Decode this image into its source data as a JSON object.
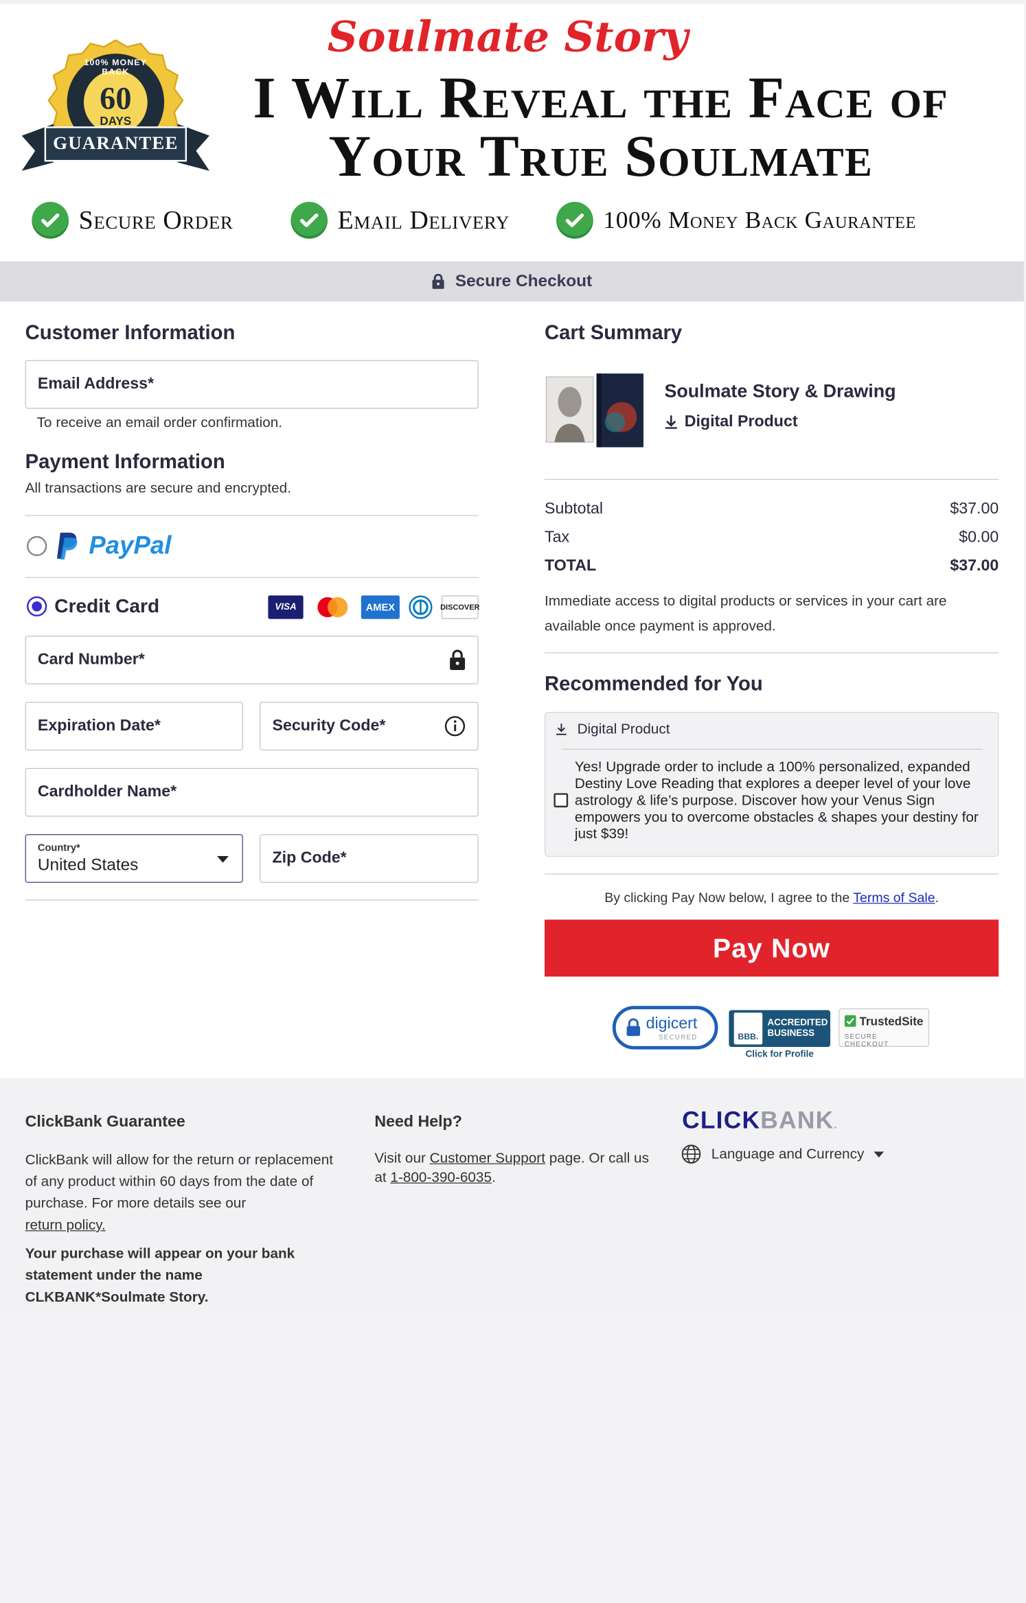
{
  "banner": {
    "brand": "Soulmate Story",
    "headline_line1": "I Will Reveal the Face of",
    "headline_line2": "Your True Soulmate",
    "badge": {
      "top_text": "100% MONEY BACK",
      "number": "60",
      "unit": "DAYS",
      "ribbon": "GUARANTEE"
    },
    "trust_items": [
      "Secure Order",
      "Email Delivery",
      "100% Money Back Gaurantee"
    ]
  },
  "secure_bar": {
    "label": "Secure Checkout"
  },
  "customer": {
    "heading": "Customer Information",
    "email_placeholder": "Email Address*",
    "email_hint": "To receive an email order confirmation."
  },
  "payment": {
    "heading": "Payment Information",
    "subheading": "All transactions are secure and encrypted.",
    "paypal_label": "PayPal",
    "credit_label": "Credit Card",
    "selected_method": "credit-card",
    "card_brands": [
      "VISA",
      "MasterCard",
      "AMEX",
      "Diners",
      "DISCOVER"
    ],
    "card_number_placeholder": "Card Number*",
    "expiration_placeholder": "Expiration Date*",
    "security_placeholder": "Security Code*",
    "cardholder_placeholder": "Cardholder Name*",
    "country_label": "Country*",
    "country_value": "United States",
    "zip_placeholder": "Zip Code*"
  },
  "cart": {
    "heading": "Cart Summary",
    "product_name": "Soulmate Story & Drawing",
    "product_type": "Digital Product",
    "subtotal_label": "Subtotal",
    "subtotal_value": "$37.00",
    "tax_label": "Tax",
    "tax_value": "$0.00",
    "total_label": "TOTAL",
    "total_value": "$37.00",
    "access_note": "Immediate access to digital products or services in your cart are available once payment is approved."
  },
  "recommended": {
    "heading": "Recommended for You",
    "type": "Digital Product",
    "text": "Yes! Upgrade order to include a 100% personalized, expanded Destiny Love Reading that explores a deeper level of your love astrology & life’s purpose. Discover how your Venus Sign empowers you to overcome obstacles & shapes your destiny for just $39!",
    "checked": false
  },
  "agreement": {
    "prefix": "By clicking Pay Now below, I agree to the ",
    "link": "Terms of Sale",
    "suffix": "."
  },
  "pay_button": "Pay Now",
  "seals": {
    "digicert": "digicert",
    "digicert_sub": "SECURED",
    "bbb_line1": "ACCREDITED",
    "bbb_line2": "BUSINESS",
    "bbb_short": "BBB.",
    "bbb_caption": "Click for Profile",
    "trustedsite": "TrustedSite",
    "trustedsite_sub": "SECURE CHECKOUT"
  },
  "footer": {
    "guarantee_heading": "ClickBank Guarantee",
    "guarantee_text": "ClickBank will allow for the return or replacement of any product within 60 days from the date of purchase. For more details see our",
    "return_link": "return policy.",
    "statement_text": "Your purchase will appear on your bank statement under the name CLKBANK*Soulmate Story.",
    "help_heading": "Need Help?",
    "help_prefix": "Visit our ",
    "support_link": "Customer Support",
    "help_mid": " page. Or call us at ",
    "phone_link": "1-800-390-6035",
    "help_suffix": ".",
    "logo_click": "CLICK",
    "logo_bank": "BANK",
    "logo_mark": ".",
    "language_label": "Language and Currency"
  },
  "colors": {
    "accent": "#e1232b",
    "brand_red": "#e0242a",
    "check_green": "#3fa84a",
    "radio_blue": "#3a2bd0",
    "clickbank_navy": "#1d1f8c"
  }
}
